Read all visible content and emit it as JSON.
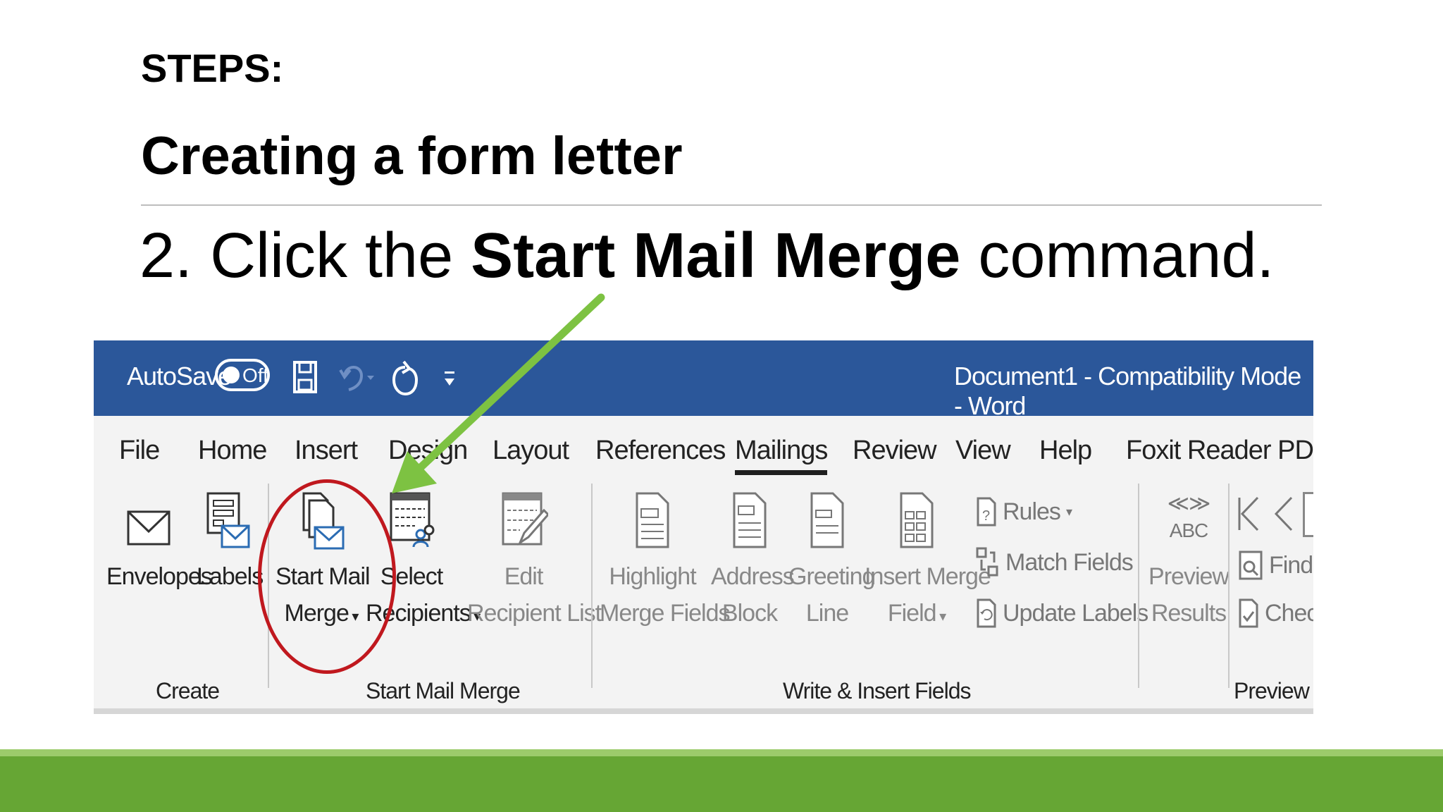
{
  "slide": {
    "heading": "STEPS:",
    "subtitle": "Creating a form letter",
    "instruction_prefix": "2. Click the ",
    "instruction_bold": "Start Mail Merge",
    "instruction_suffix": " command."
  },
  "titlebar": {
    "autosave_label": "AutoSave",
    "autosave_state": "Off",
    "document_title": "Document1  -  Compatibility Mode  -  Word",
    "bg_color": "#2b579a"
  },
  "tabs": [
    {
      "label": "File"
    },
    {
      "label": "Home"
    },
    {
      "label": "Insert"
    },
    {
      "label": "Design"
    },
    {
      "label": "Layout"
    },
    {
      "label": "References"
    },
    {
      "label": "Mailings",
      "active": true
    },
    {
      "label": "Review"
    },
    {
      "label": "View"
    },
    {
      "label": "Help"
    },
    {
      "label": "Foxit Reader PDF"
    }
  ],
  "ribbon": {
    "envelopes": "Envelopes",
    "labels": "Labels",
    "start_mail_merge_1": "Start Mail",
    "start_mail_merge_2": "Merge",
    "select_recipients_1": "Select",
    "select_recipients_2": "Recipients",
    "edit_recipient_1": "Edit",
    "edit_recipient_2": "Recipient List",
    "highlight_1": "Highlight",
    "highlight_2": "Merge Fields",
    "address_1": "Address",
    "address_2": "Block",
    "greeting_1": "Greeting",
    "greeting_2": "Line",
    "insert_merge_1": "Insert Merge",
    "insert_merge_2": "Field",
    "rules": "Rules",
    "match_fields": "Match Fields",
    "update_labels": "Update Labels",
    "preview_abc": "ABC",
    "preview_1": "Preview",
    "preview_2": "Results",
    "find_partial": "Find F",
    "check_partial": "Check",
    "group_create": "Create",
    "group_start": "Start Mail Merge",
    "group_write": "Write & Insert Fields",
    "group_preview_partial": "Preview Re"
  },
  "annotation_colors": {
    "circle": "#c0181e",
    "arrow": "#7dc242",
    "band": "#66a634"
  }
}
